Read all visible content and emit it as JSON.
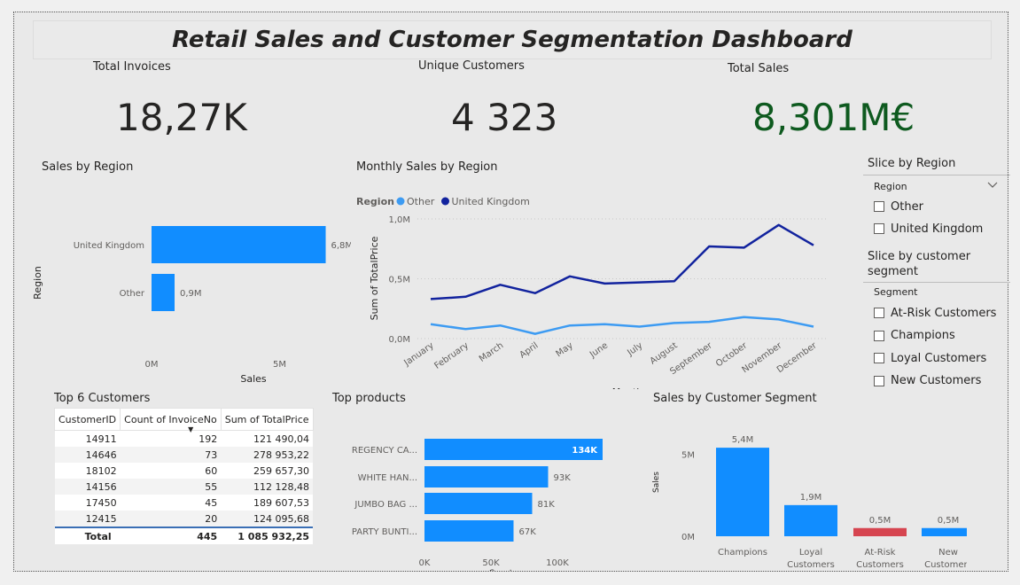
{
  "title": "Retail Sales and Customer Segmentation Dashboard",
  "kpis": [
    {
      "label": "Total Invoices",
      "value": "18,27K",
      "color": "#252423"
    },
    {
      "label": "Unique Customers",
      "value": "4 323",
      "color": "#252423"
    },
    {
      "label": "Total Sales",
      "value": "8,301M€",
      "color": "#0e5a1f"
    }
  ],
  "slicers": {
    "region": {
      "title": "Slice by Region",
      "header": "Region",
      "items": [
        "Other",
        "United Kingdom"
      ]
    },
    "segment": {
      "title": "Slice by customer segment",
      "header": "Segment",
      "items": [
        "At-Risk Customers",
        "Champions",
        "Loyal Customers",
        "New Customers"
      ]
    }
  },
  "table": {
    "title": "Top 6 Customers",
    "columns": [
      "CustomerID",
      "Count of InvoiceNo",
      "Sum of TotalPrice"
    ],
    "rows": [
      [
        "14911",
        "192",
        "121 490,04"
      ],
      [
        "14646",
        "73",
        "278 953,22"
      ],
      [
        "18102",
        "60",
        "259 657,30"
      ],
      [
        "14156",
        "55",
        "112 128,48"
      ],
      [
        "17450",
        "45",
        "189 607,53"
      ],
      [
        "12415",
        "20",
        "124 095,68"
      ]
    ],
    "total": [
      "Total",
      "445",
      "1 085 932,25"
    ]
  },
  "chart_data": [
    {
      "type": "bar",
      "orientation": "horizontal",
      "title": "Sales by Region",
      "categories": [
        "United Kingdom",
        "Other"
      ],
      "values": [
        6.8,
        0.9
      ],
      "data_labels": [
        "6,8M",
        "0,9M"
      ],
      "xlabel": "Sales",
      "ylabel": "Region",
      "x_ticks": [
        "0M",
        "5M"
      ],
      "xlim": [
        0,
        7.2
      ],
      "color": "#118dff"
    },
    {
      "type": "line",
      "title": "Monthly Sales by Region",
      "legend_title": "Region",
      "x": [
        "January",
        "February",
        "March",
        "April",
        "May",
        "June",
        "July",
        "August",
        "September",
        "October",
        "November",
        "December"
      ],
      "series": [
        {
          "name": "Other",
          "color": "#3d9bf2",
          "values": [
            0.12,
            0.08,
            0.11,
            0.04,
            0.11,
            0.12,
            0.1,
            0.13,
            0.14,
            0.18,
            0.16,
            0.1
          ]
        },
        {
          "name": "United Kingdom",
          "color": "#12239e",
          "values": [
            0.33,
            0.35,
            0.45,
            0.38,
            0.52,
            0.46,
            0.47,
            0.48,
            0.77,
            0.76,
            0.95,
            0.78
          ]
        }
      ],
      "xlabel": "Month",
      "ylabel": "Sum of TotalPrice",
      "y_ticks": [
        "0,0M",
        "0,5M",
        "1,0M"
      ],
      "ylim": [
        0,
        1.0
      ],
      "legend_position": "top-left",
      "grid": true
    },
    {
      "type": "bar",
      "orientation": "horizontal",
      "title": "Top products",
      "categories": [
        "REGENCY CA...",
        "WHITE HAN...",
        "JUMBO BAG ...",
        "PARTY BUNTI..."
      ],
      "values": [
        134,
        93,
        81,
        67
      ],
      "data_labels": [
        "134K",
        "93K",
        "81K",
        "67K"
      ],
      "xlabel": "Count",
      "x_ticks": [
        "0K",
        "50K",
        "100K"
      ],
      "xlim": [
        0,
        150
      ],
      "color": "#118dff"
    },
    {
      "type": "bar",
      "orientation": "vertical",
      "title": "Sales by Customer Segment",
      "categories": [
        "Champions",
        "Loyal Customers",
        "At-Risk Customers",
        "New Customers"
      ],
      "category_lines": [
        [
          "Champions"
        ],
        [
          "Loyal",
          "Customers"
        ],
        [
          "At-Risk",
          "Customers"
        ],
        [
          "New",
          "Customers"
        ]
      ],
      "values": [
        5.4,
        1.9,
        0.5,
        0.5
      ],
      "data_labels": [
        "5,4M",
        "1,9M",
        "0,5M",
        "0,5M"
      ],
      "colors": [
        "#118dff",
        "#118dff",
        "#d64550",
        "#118dff"
      ],
      "xlabel": "Segment",
      "ylabel": "Sales",
      "y_ticks": [
        "0M",
        "5M"
      ],
      "ylim": [
        0,
        5.8
      ]
    }
  ]
}
